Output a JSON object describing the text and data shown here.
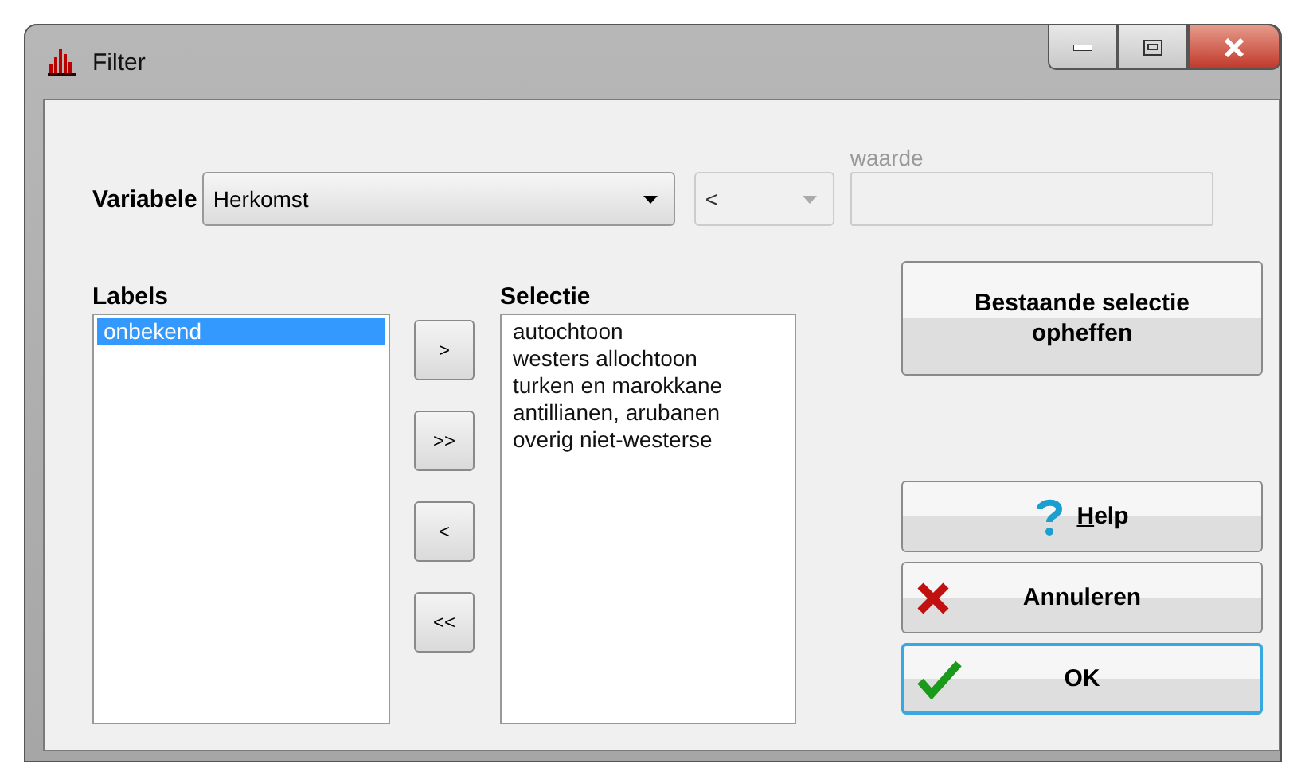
{
  "window": {
    "title": "Filter"
  },
  "variable": {
    "label": "Variabele",
    "value": "Herkomst"
  },
  "operator": {
    "value": "<",
    "disabled": true
  },
  "waarde": {
    "label": "waarde",
    "disabled": true
  },
  "labels": {
    "heading": "Labels",
    "items": [
      {
        "text": "onbekend",
        "selected": true
      }
    ]
  },
  "transfer_buttons": [
    ">",
    ">>",
    "<",
    "<<"
  ],
  "selectie": {
    "heading": "Selectie",
    "items": [
      {
        "text": "autochtoon",
        "selected": false
      },
      {
        "text": "westers allochtoon",
        "selected": false
      },
      {
        "text": "turken en marokkane",
        "selected": false
      },
      {
        "text": "antillianen, arubanen",
        "selected": false
      },
      {
        "text": "overig niet-westerse",
        "selected": false
      }
    ]
  },
  "clear_button": {
    "label": "Bestaande selectie opheffen"
  },
  "buttons": [
    {
      "kind": "help",
      "label": "Help",
      "focused": false
    },
    {
      "kind": "cancel",
      "label": "Annuleren",
      "focused": false
    },
    {
      "kind": "ok",
      "label": "OK",
      "focused": true
    }
  ]
}
